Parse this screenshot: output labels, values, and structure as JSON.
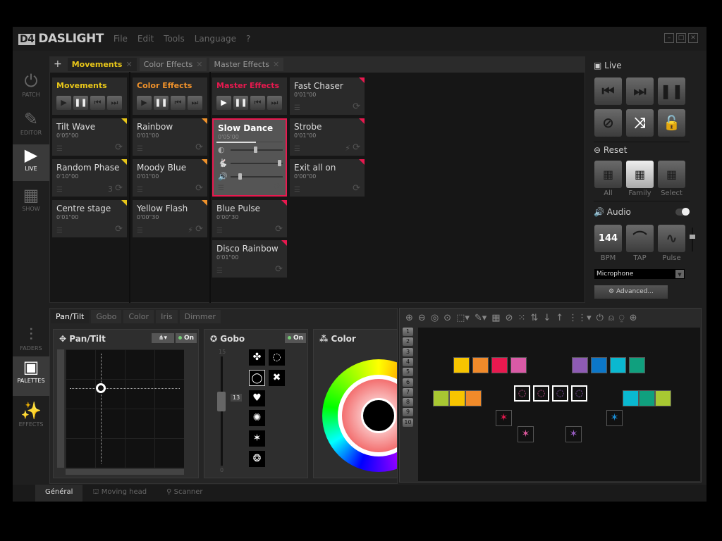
{
  "app": {
    "title": "DASLIGHT",
    "logo": "D4",
    "menu": [
      "File",
      "Edit",
      "Tools",
      "Language",
      "?"
    ]
  },
  "sidebar": [
    {
      "label": "PATCH",
      "icon": "patch-icon"
    },
    {
      "label": "EDITOR",
      "icon": "editor-icon"
    },
    {
      "label": "LIVE",
      "icon": "live-icon",
      "active": true
    },
    {
      "label": "SHOW",
      "icon": "show-icon"
    }
  ],
  "sidebar_bottom": [
    {
      "label": "FADERS",
      "icon": "faders-icon"
    },
    {
      "label": "PALETTES",
      "icon": "palettes-icon",
      "active": true
    },
    {
      "label": "EFFECTS",
      "icon": "effects-icon"
    }
  ],
  "top_tabs": [
    {
      "label": "Movements",
      "active": true
    },
    {
      "label": "Color Effects"
    },
    {
      "label": "Master Effects"
    }
  ],
  "columns": [
    {
      "title": "Movements",
      "color": "#e8c619",
      "cards": [
        {
          "name": "Tilt Wave",
          "time": "0'05\"00"
        },
        {
          "name": "Random Phase",
          "time": "0'10\"00",
          "extra": "3"
        },
        {
          "name": "Centre stage",
          "time": "0'01\"00"
        }
      ]
    },
    {
      "title": "Color Effects",
      "color": "#f0922b",
      "cards": [
        {
          "name": "Rainbow",
          "time": "0'01\"00"
        },
        {
          "name": "Moody Blue",
          "time": "0'01\"00"
        },
        {
          "name": "Yellow Flash",
          "time": "0'00\"30",
          "extra": "⚡"
        }
      ]
    },
    {
      "title": "Master Effects",
      "color": "#e8194f",
      "cards": [
        {
          "name": "Slow Dance",
          "time": "0'05'00",
          "selected": true
        },
        {
          "name": "Blue Pulse",
          "time": "0'00\"30"
        },
        {
          "name": "Disco Rainbow",
          "time": "0'01\"00"
        }
      ]
    },
    {
      "title": "",
      "color": "#e8194f",
      "cards": [
        {
          "name": "Fast Chaser",
          "time": "0'01\"00"
        },
        {
          "name": "Strobe",
          "time": "0'01\"00",
          "extra": "⚡"
        },
        {
          "name": "Exit all on",
          "time": "0'00\"00"
        }
      ]
    }
  ],
  "slow_dance_sliders": {
    "dimmer": 0.45,
    "speed": 0.9,
    "audio": 0.15,
    "progress": 0.6
  },
  "live": {
    "title": "Live",
    "buttons": [
      "previous",
      "next",
      "pause",
      "stop",
      "shuffle",
      "lock"
    ]
  },
  "reset": {
    "title": "Reset",
    "options": [
      "All",
      "Family",
      "Select"
    ],
    "selected": "Family"
  },
  "audio": {
    "title": "Audio",
    "enabled": true,
    "bpm_value": "144",
    "buttons": [
      "BPM",
      "TAP",
      "Pulse"
    ],
    "input": "Microphone",
    "advanced": "Advanced..."
  },
  "palette_tabs": [
    {
      "label": "Pan/Tilt",
      "active": true
    },
    {
      "label": "Gobo"
    },
    {
      "label": "Color"
    },
    {
      "label": "Iris"
    },
    {
      "label": "Dimmer"
    }
  ],
  "pantilt": {
    "title": "Pan/Tilt",
    "on": "On",
    "pan": 0.3,
    "tilt": 0.33
  },
  "gobo": {
    "title": "Gobo",
    "on": "On",
    "max": "15",
    "min": "0",
    "value": "13"
  },
  "color": {
    "title": "Color"
  },
  "stage": {
    "rows": [
      "1",
      "2",
      "3",
      "4",
      "5",
      "6",
      "7",
      "8",
      "9",
      "10"
    ],
    "fixtures": [
      "#f7c400",
      "#f08a2a",
      "#e8194f",
      "#d95aa6",
      "#8e5bb4",
      "#0c77c8",
      "#0ab8d0",
      "#10a07e",
      "#a8c832",
      "#f7c400",
      "#f08a2a",
      "#0ab8d0",
      "#10a07e",
      "#a8c832"
    ],
    "gobo_colors": [
      "#e05aa0",
      "#e05aa0",
      "#9a5ec4",
      "#9a5ec4"
    ],
    "star_colors": [
      "#e8194f",
      "#e05aa0",
      "#1a8fd8",
      "#9a5ec4"
    ]
  },
  "bottom_tabs": [
    {
      "label": "Général",
      "active": true
    },
    {
      "label": "Moving head"
    },
    {
      "label": "Scanner"
    }
  ]
}
